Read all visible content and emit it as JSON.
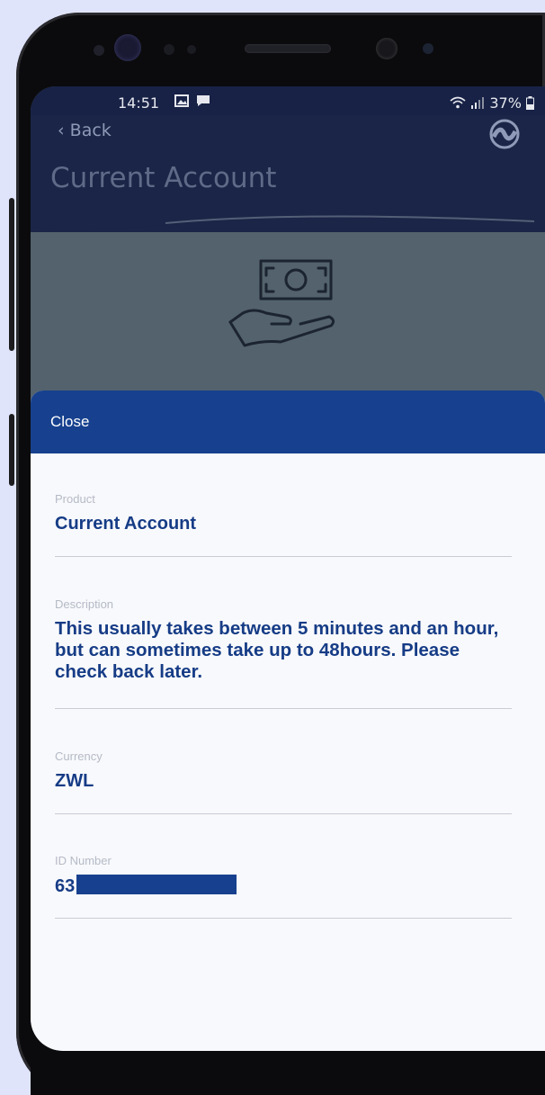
{
  "status_bar": {
    "time": "14:51",
    "left_icons": [
      "image-icon",
      "message-icon"
    ],
    "battery": "37%",
    "right_icons": [
      "wifi-icon",
      "signal-icon",
      "battery-icon"
    ]
  },
  "header": {
    "back_label": "Back",
    "title": "Current Account",
    "logo_icon": "logo-icon",
    "hero_icon": "hand-money-icon"
  },
  "sheet": {
    "close_label": "Close",
    "fields": [
      {
        "label": "Product",
        "value": "Current Account"
      },
      {
        "label": "Description",
        "value": "This usually takes between 5 minutes and an hour, but can sometimes take up to 48hours. Please check back later."
      },
      {
        "label": "Currency",
        "value": "ZWL"
      },
      {
        "label": "ID Number",
        "value": "63"
      }
    ]
  },
  "colors": {
    "header_bg": "#1a2547",
    "sheet_bar_bg": "#17418e",
    "value_text": "#163c86",
    "label_text": "#b5bac6",
    "hero_bg": "#53626d"
  }
}
